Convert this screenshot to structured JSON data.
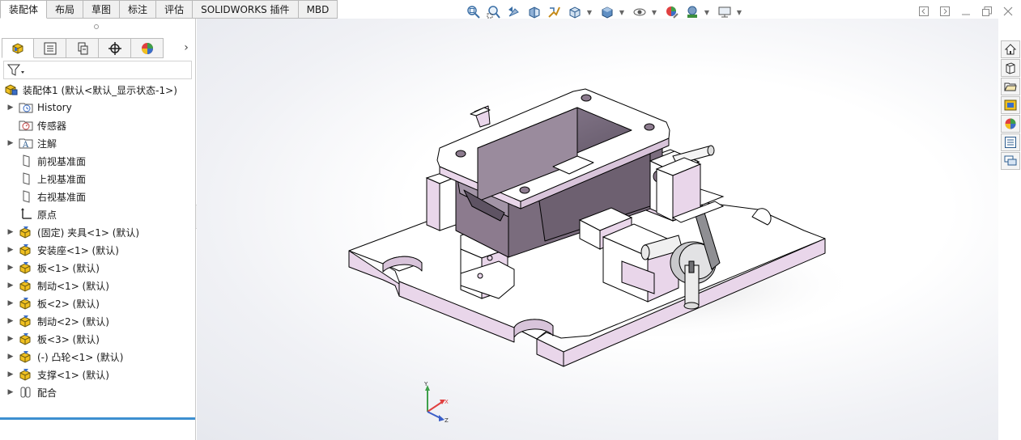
{
  "tabs": [
    {
      "label": "装配体",
      "active": true
    },
    {
      "label": "布局"
    },
    {
      "label": "草图"
    },
    {
      "label": "标注"
    },
    {
      "label": "评估"
    },
    {
      "label": "SOLIDWORKS 插件"
    },
    {
      "label": "MBD"
    }
  ],
  "hud_icons": [
    "zoom-to-fit-icon",
    "zoom-area-icon",
    "previous-view-icon",
    "section-view-icon",
    "dynamic-annotation-icon",
    "view-orientation-icon",
    "display-style-icon",
    "hide-show-items-icon",
    "edit-appearance-icon",
    "apply-scene-icon",
    "view-settings-icon"
  ],
  "feature_manager": {
    "panel_tabs": [
      "featuremanager-tree-icon",
      "propertymanager-icon",
      "configurationmanager-icon",
      "dimxpertmanager-icon",
      "displaymanager-icon"
    ],
    "root": {
      "label": "装配体1  (默认<默认_显示状态-1>)"
    },
    "items": [
      {
        "label": "History",
        "icon": "history-folder-icon",
        "expandable": true
      },
      {
        "label": "传感器",
        "icon": "sensor-icon",
        "expandable": false
      },
      {
        "label": "注解",
        "icon": "annotation-icon",
        "expandable": true
      },
      {
        "label": "前视基准面",
        "icon": "plane-icon",
        "expandable": false
      },
      {
        "label": "上视基准面",
        "icon": "plane-icon",
        "expandable": false
      },
      {
        "label": "右视基准面",
        "icon": "plane-icon",
        "expandable": false
      },
      {
        "label": "原点",
        "icon": "origin-icon",
        "expandable": false
      },
      {
        "label": "(固定) 夹具<1> (默认)",
        "icon": "part-icon",
        "expandable": true
      },
      {
        "label": "安装座<1> (默认)",
        "icon": "part-icon",
        "expandable": true
      },
      {
        "label": "板<1> (默认)",
        "icon": "part-icon",
        "expandable": true
      },
      {
        "label": "制动<1> (默认)",
        "icon": "part-icon",
        "expandable": true
      },
      {
        "label": "板<2> (默认)",
        "icon": "part-icon",
        "expandable": true
      },
      {
        "label": "制动<2> (默认)",
        "icon": "part-icon",
        "expandable": true
      },
      {
        "label": "板<3> (默认)",
        "icon": "part-icon",
        "expandable": true
      },
      {
        "label": "(-) 凸轮<1> (默认)",
        "icon": "part-icon",
        "expandable": true
      },
      {
        "label": "支撑<1> (默认)",
        "icon": "part-icon",
        "expandable": true
      },
      {
        "label": "配合",
        "icon": "mates-icon",
        "expandable": true
      }
    ]
  },
  "triad": {
    "x": "X",
    "y": "Y",
    "z": "Z"
  },
  "task_pane": [
    "solidworks-resources-icon",
    "design-library-icon",
    "file-explorer-icon",
    "view-palette-icon",
    "appearances-scenes-icon",
    "custom-properties-icon",
    "forum-icon"
  ],
  "colors": {
    "accent": "#3d8fd0",
    "part_face": "#ffffff",
    "part_side": "#e9d6ea",
    "part_dark": "#8c7b8e"
  }
}
